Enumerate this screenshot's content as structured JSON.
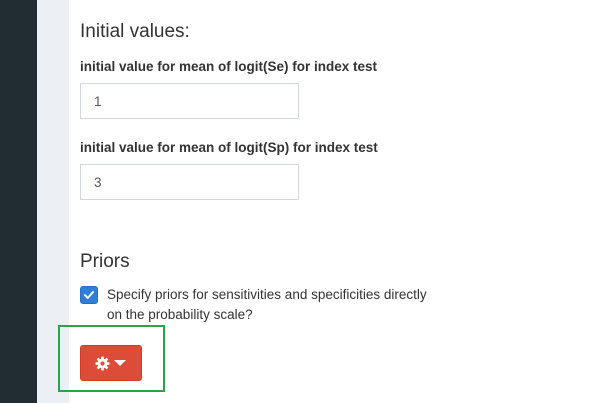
{
  "initial_values": {
    "heading": "Initial values:",
    "se_label": "initial value for mean of logit(Se) for index test",
    "se_value": "1",
    "sp_label": "initial value for mean of logit(Sp) for index test",
    "sp_value": "3"
  },
  "priors": {
    "heading": "Priors",
    "checkbox_label": "Specify priors for sensitivities and specificities directly on the probability scale?",
    "checkbox_checked": true
  },
  "settings_button": {
    "icon": "gear-icon",
    "caret_icon": "caret-down-icon"
  },
  "colors": {
    "sidebar": "#222d32",
    "strip": "#ecf0f5",
    "checkbox": "#2f7ed8",
    "button": "#dd4b39",
    "highlight": "#22a84a"
  }
}
